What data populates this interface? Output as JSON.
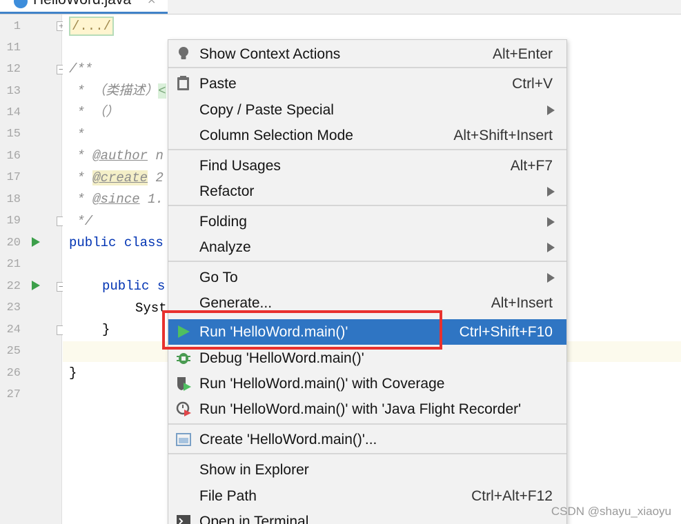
{
  "tab": {
    "title": "HelloWord.java",
    "close": "×"
  },
  "gutter": {
    "lines": [
      "1",
      "11",
      "12",
      "13",
      "14",
      "15",
      "16",
      "17",
      "18",
      "19",
      "20",
      "21",
      "22",
      "23",
      "24",
      "25",
      "26",
      "27"
    ]
  },
  "code": {
    "l1": "/.../",
    "l12": "/**",
    "l13_star": " *",
    "l13_text": "（类描述）",
    "l13_tag": "<",
    "l14_star": " *",
    "l14_text": "（）",
    "l15": " *",
    "l16_star": " * ",
    "l16_tag": "@author",
    "l16_rest": " n",
    "l17_star": " * ",
    "l17_tag": "@create",
    "l17_rest": " 2",
    "l18_star": " * ",
    "l18_tag": "@since",
    "l18_rest": " 1.",
    "l19": " */",
    "l20_kw": "public class",
    "l22_kw": "public s",
    "l23": "Syst",
    "l24": "}",
    "l26": "}"
  },
  "menu": {
    "items": [
      {
        "label": "Show Context Actions",
        "shortcut": "Alt+Enter",
        "icon": "bulb-icon"
      },
      {
        "label": "Paste",
        "shortcut": "Ctrl+V",
        "icon": "clipboard-icon"
      },
      {
        "label": "Copy / Paste Special",
        "shortcut": "",
        "submenu": true
      },
      {
        "label": "Column Selection Mode",
        "shortcut": "Alt+Shift+Insert"
      },
      {
        "label": "Find Usages",
        "shortcut": "Alt+F7"
      },
      {
        "label": "Refactor",
        "shortcut": "",
        "submenu": true
      },
      {
        "label": "Folding",
        "shortcut": "",
        "submenu": true
      },
      {
        "label": "Analyze",
        "shortcut": "",
        "submenu": true
      },
      {
        "label": "Go To",
        "shortcut": "",
        "submenu": true
      },
      {
        "label": "Generate...",
        "shortcut": "Alt+Insert"
      },
      {
        "label": "Run 'HelloWord.main()'",
        "shortcut": "Ctrl+Shift+F10",
        "icon": "run-icon",
        "selected": true
      },
      {
        "label": "Debug 'HelloWord.main()'",
        "shortcut": "",
        "icon": "debug-icon"
      },
      {
        "label": "Run 'HelloWord.main()' with Coverage",
        "shortcut": "",
        "icon": "coverage-icon"
      },
      {
        "label": "Run 'HelloWord.main()' with 'Java Flight Recorder'",
        "shortcut": "",
        "icon": "profiler-icon"
      },
      {
        "label": "Create 'HelloWord.main()'...",
        "shortcut": "",
        "icon": "run-config-icon"
      },
      {
        "label": "Show in Explorer",
        "shortcut": ""
      },
      {
        "label": "File Path",
        "shortcut": "Ctrl+Alt+F12"
      },
      {
        "label": "Open in Terminal",
        "shortcut": "",
        "icon": "terminal-icon"
      }
    ]
  },
  "colors": {
    "selection": "#2f75c3",
    "highlight_box": "#e8312e",
    "run_green": "#3c9f4a"
  },
  "watermark": "CSDN @shayu_xiaoyu"
}
